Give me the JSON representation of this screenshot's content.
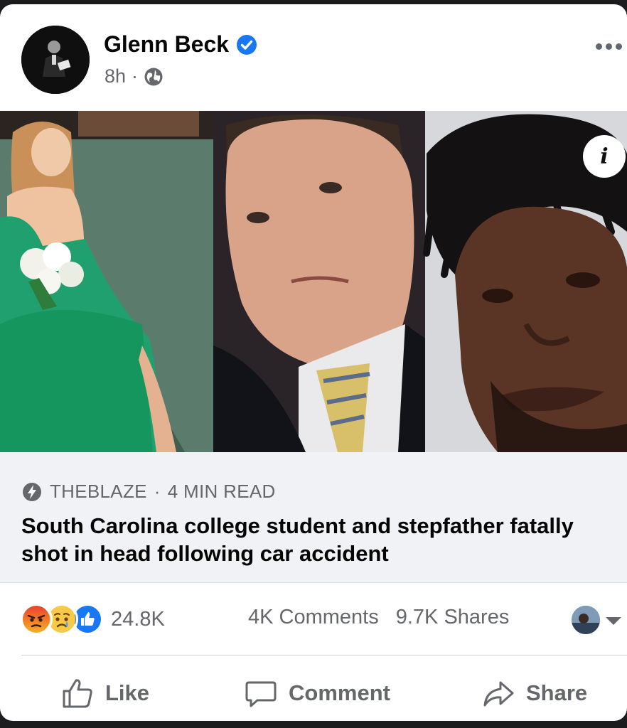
{
  "post": {
    "author": "Glenn Beck",
    "time": "8h",
    "separator": "·",
    "audience_icon": "globe-icon",
    "verified_icon": "verified-badge-icon",
    "more_icon": "more-options-icon"
  },
  "link": {
    "source": "THEBLAZE",
    "read_time": "4 MIN READ",
    "source_separator": "·",
    "headline": "South Carolina college student and stepfather fatally shot in head following car accident",
    "info_icon": "info-icon"
  },
  "engagement": {
    "reactions": [
      "angry-reaction-icon",
      "sad-reaction-icon",
      "like-reaction-icon"
    ],
    "reaction_count": "24.8K",
    "comments": "4K Comments",
    "shares": "9.7K Shares"
  },
  "actions": {
    "like": "Like",
    "comment": "Comment",
    "share": "Share"
  },
  "colors": {
    "text_secondary": "#65676b",
    "text_primary": "#050505",
    "verified_blue": "#1877f2",
    "preview_bg": "#f0f2f5"
  }
}
